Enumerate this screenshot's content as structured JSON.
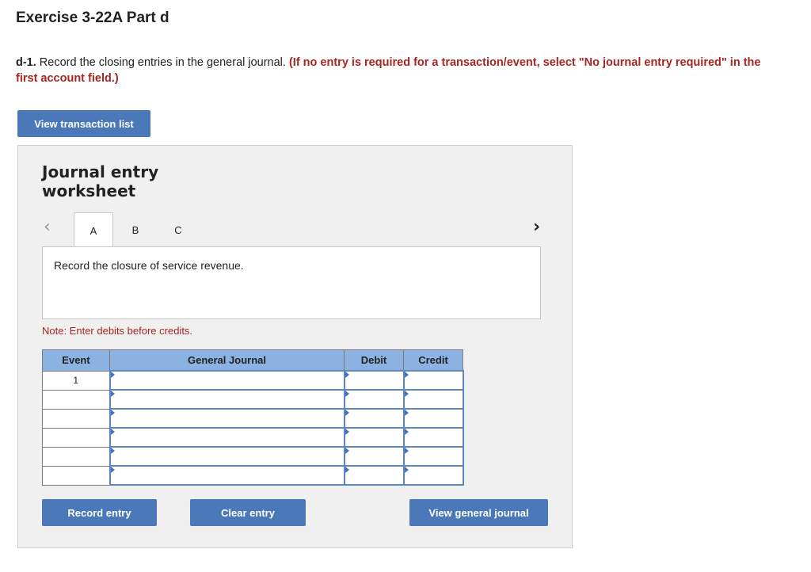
{
  "page": {
    "title": "Exercise 3-22A Part d",
    "instruction_label": "d-1.",
    "instruction_text": " Record the closing entries in the general journal. ",
    "instruction_emphasis": "(If no entry is required for a transaction/event, select \"No journal entry required\" in the first account field.)"
  },
  "buttons": {
    "view_transaction_list": "View transaction list",
    "record_entry": "Record entry",
    "clear_entry": "Clear entry",
    "view_general_journal": "View general journal"
  },
  "worksheet": {
    "title_line1": "Journal entry",
    "title_line2": "worksheet",
    "prev_icon": "chevron-left-icon",
    "next_icon": "chevron-right-icon",
    "tabs": [
      "A",
      "B",
      "C"
    ],
    "active_tab": "A",
    "description": "Record the closure of service revenue.",
    "note": "Note: Enter debits before credits."
  },
  "journal": {
    "headers": {
      "event": "Event",
      "account": "General Journal",
      "debit": "Debit",
      "credit": "Credit"
    },
    "rows": [
      {
        "event": "1",
        "account": "",
        "debit": "",
        "credit": ""
      },
      {
        "event": "",
        "account": "",
        "debit": "",
        "credit": ""
      },
      {
        "event": "",
        "account": "",
        "debit": "",
        "credit": ""
      },
      {
        "event": "",
        "account": "",
        "debit": "",
        "credit": ""
      },
      {
        "event": "",
        "account": "",
        "debit": "",
        "credit": ""
      },
      {
        "event": "",
        "account": "",
        "debit": "",
        "credit": ""
      }
    ]
  },
  "colors": {
    "button_blue": "#4a78b8",
    "header_blue": "#8bb2e0",
    "instruction_red": "#a8251f",
    "panel_gray": "#f0f0f0"
  }
}
